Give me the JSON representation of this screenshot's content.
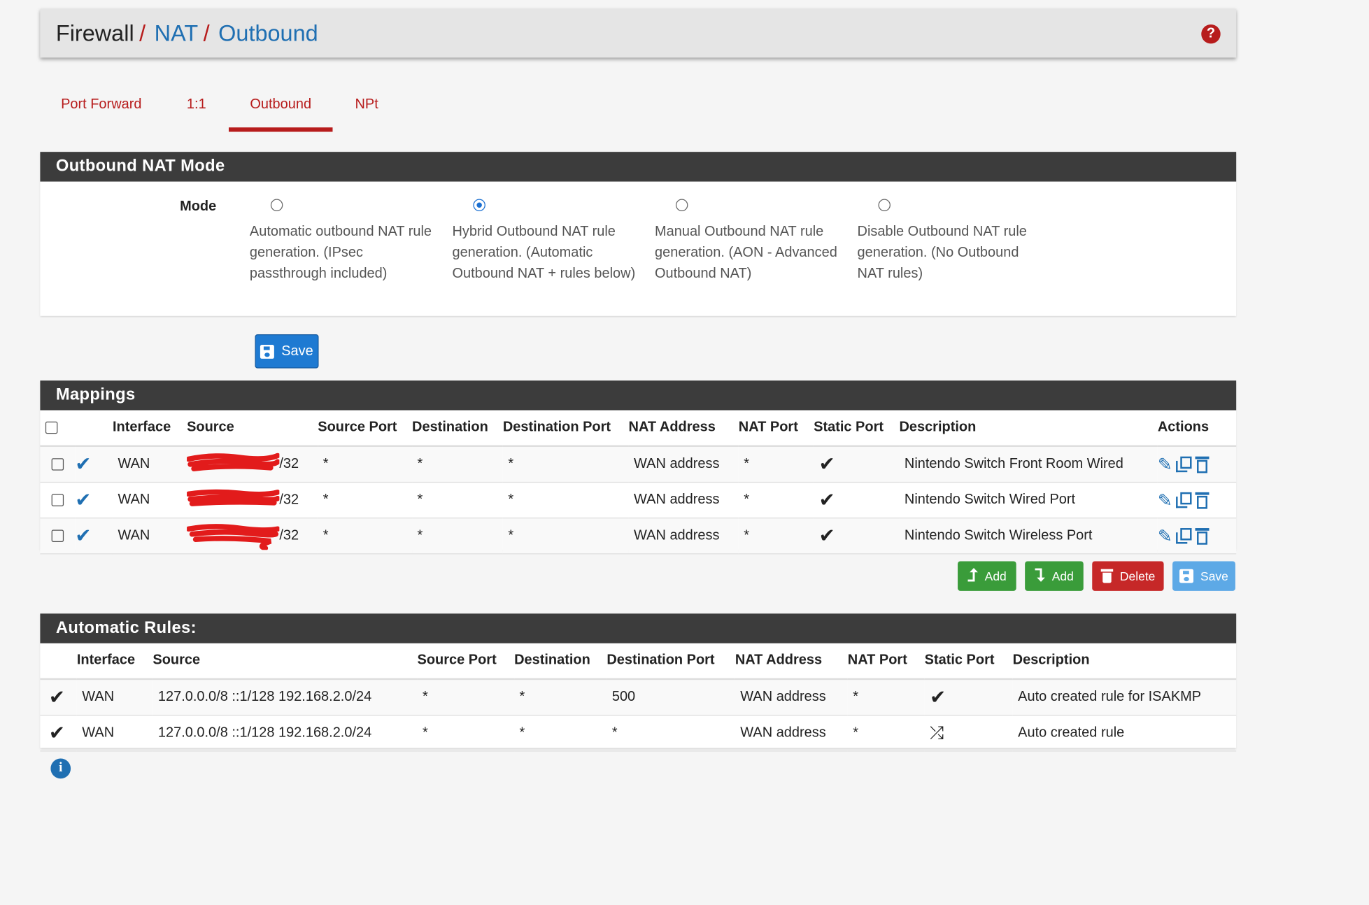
{
  "breadcrumb": [
    "Firewall",
    "NAT",
    "Outbound"
  ],
  "tabs": [
    {
      "label": "Port Forward"
    },
    {
      "label": "1:1"
    },
    {
      "label": "Outbound"
    },
    {
      "label": "NPt"
    }
  ],
  "active_tab": "Outbound",
  "mode_panel": {
    "title": "Outbound NAT Mode",
    "mode_label": "Mode",
    "options": [
      {
        "label": "Automatic outbound NAT rule generation. (IPsec passthrough included)",
        "selected": false
      },
      {
        "label": "Hybrid Outbound NAT rule generation. (Automatic Outbound NAT + rules below)",
        "selected": true
      },
      {
        "label": "Manual Outbound NAT rule generation. (AON - Advanced Outbound NAT)",
        "selected": false
      },
      {
        "label": "Disable Outbound NAT rule generation. (No Outbound NAT rules)",
        "selected": false
      }
    ],
    "save_label": "Save"
  },
  "mappings": {
    "title": "Mappings",
    "columns": [
      "Interface",
      "Source",
      "Source Port",
      "Destination",
      "Destination Port",
      "NAT Address",
      "NAT Port",
      "Static Port",
      "Description",
      "Actions"
    ],
    "rows": [
      {
        "interface": "WAN",
        "source_suffix": "/32",
        "source_port": "*",
        "destination": "*",
        "destination_port": "*",
        "nat_address": "WAN address",
        "nat_port": "*",
        "description": "Nintendo Switch Front Room Wired"
      },
      {
        "interface": "WAN",
        "source_suffix": "/32",
        "source_port": "*",
        "destination": "*",
        "destination_port": "*",
        "nat_address": "WAN address",
        "nat_port": "*",
        "description": "Nintendo Switch Wired Port"
      },
      {
        "interface": "WAN",
        "source_suffix": "/32",
        "source_port": "*",
        "destination": "*",
        "destination_port": "*",
        "nat_address": "WAN address",
        "nat_port": "*",
        "description": "Nintendo Switch Wireless Port"
      }
    ],
    "buttons": {
      "add_top": "Add",
      "add_bottom": "Add",
      "delete": "Delete",
      "save": "Save"
    }
  },
  "automatic_rules": {
    "title": "Automatic Rules:",
    "columns": [
      "Interface",
      "Source",
      "Source Port",
      "Destination",
      "Destination Port",
      "NAT Address",
      "NAT Port",
      "Static Port",
      "Description"
    ],
    "rows": [
      {
        "interface": "WAN",
        "source": "127.0.0.0/8 ::1/128 192.168.2.0/24",
        "source_port": "*",
        "destination": "*",
        "destination_port": "500",
        "nat_address": "WAN address",
        "nat_port": "*",
        "static_port_icon": "check-icon",
        "description": "Auto created rule for ISAKMP"
      },
      {
        "interface": "WAN",
        "source": "127.0.0.0/8 ::1/128 192.168.2.0/24",
        "source_port": "*",
        "destination": "*",
        "destination_port": "*",
        "nat_address": "WAN address",
        "nat_port": "*",
        "static_port_icon": "random-icon",
        "description": "Auto created rule"
      }
    ]
  },
  "colors": {
    "brand_red": "#b71c1c",
    "link_blue": "#1f6fb2",
    "panel_header": "#3c3c3c",
    "success": "#3a9c3a",
    "danger": "#c62828"
  }
}
